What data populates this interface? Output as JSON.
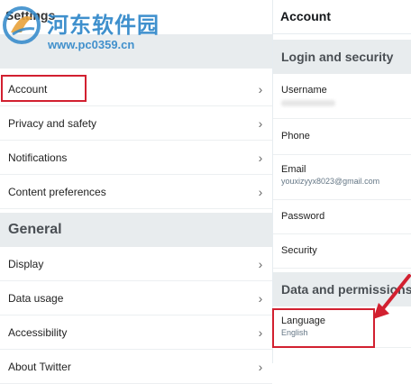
{
  "left": {
    "title": "Settings",
    "items_top": [
      {
        "label": "Account"
      },
      {
        "label": "Privacy and safety"
      },
      {
        "label": "Notifications"
      },
      {
        "label": "Content preferences"
      }
    ],
    "general_header": "General",
    "items_general": [
      {
        "label": "Display"
      },
      {
        "label": "Data usage"
      },
      {
        "label": "Accessibility"
      },
      {
        "label": "About Twitter"
      }
    ]
  },
  "right": {
    "title": "Account",
    "login_section": "Login and security",
    "items": [
      {
        "label": "Username"
      },
      {
        "label": "Phone"
      },
      {
        "label": "Email",
        "value": "youxizyyx8023@gmail.com"
      },
      {
        "label": "Password"
      },
      {
        "label": "Security"
      }
    ],
    "data_section": "Data and permissions",
    "language": {
      "label": "Language",
      "value": "English"
    }
  },
  "watermark": {
    "title": "河东软件园",
    "url": "www.pc0359.cn"
  },
  "colors": {
    "highlight_red": "#d22030",
    "section_bg": "#e8ecee",
    "watermark_blue": "#2f87c9"
  },
  "icons": {
    "chevron": "›",
    "watermark_logo": "logo-icon"
  }
}
